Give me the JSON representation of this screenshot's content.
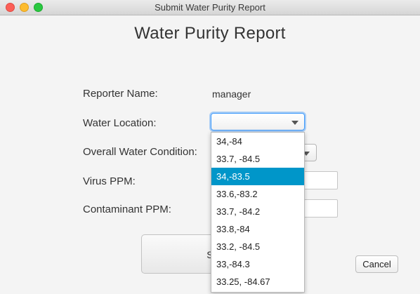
{
  "window": {
    "title": "Submit Water Purity Report"
  },
  "form": {
    "heading": "Water Purity Report",
    "reporter_label": "Reporter Name:",
    "reporter_value": "manager",
    "location_label": "Water Location:",
    "location_value": "",
    "condition_label": "Overall Water Condition:",
    "virus_label": "Virus PPM:",
    "virus_value": "",
    "contaminant_label": "Contaminant PPM:",
    "contaminant_value": "",
    "submit_label": "Submit",
    "cancel_label": "Cancel"
  },
  "dropdown": {
    "selected_index": 2,
    "options": [
      "34,-84",
      "33.7, -84.5",
      "34,-83.5",
      "33.6,-83.2",
      "33.7, -84.2",
      "33.8,-84",
      "33.2, -84.5",
      "33,-84.3",
      "33.25, -84.67"
    ]
  },
  "colors": {
    "selection": "#0096c9",
    "focus_ring": "#3b99fc"
  },
  "icons": [
    "close-icon",
    "minimize-icon",
    "maximize-icon",
    "chevron-down-icon"
  ]
}
